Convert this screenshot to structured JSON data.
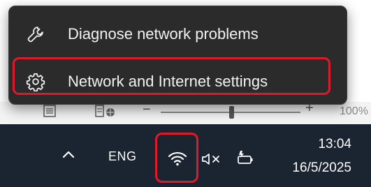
{
  "context_menu": {
    "items": [
      {
        "label": "Diagnose network problems",
        "icon": "wrench-icon"
      },
      {
        "label": "Network and Internet settings",
        "icon": "gear-icon",
        "highlighted": true
      }
    ]
  },
  "status_bar": {
    "view_icons": [
      "page-view-icon",
      "web-layout-icon"
    ],
    "zoom_minus": "−",
    "zoom_plus": "+",
    "zoom_level": "100%"
  },
  "taskbar": {
    "language": "ENG",
    "time": "13:04",
    "date": "16/5/2025",
    "icons": [
      "chevron-up-icon",
      "wifi-icon",
      "volume-muted-icon",
      "battery-charging-icon"
    ]
  },
  "colors": {
    "menu_bg": "#2b2b2b",
    "taskbar_bg": "#1b2431",
    "highlight": "#e0192a"
  }
}
